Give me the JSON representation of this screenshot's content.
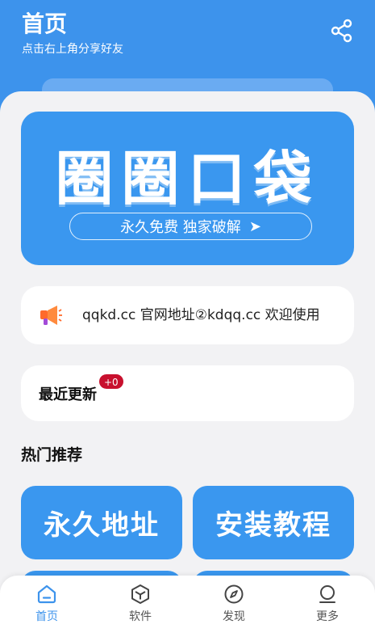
{
  "header": {
    "title": "首页",
    "subtitle": "点击右上角分享好友",
    "share_icon": "share-icon"
  },
  "banner": {
    "title": "圈圈口袋",
    "tagline": "永久免费 独家破解",
    "arrow": "➤"
  },
  "notice": {
    "icon": "megaphone-icon",
    "text": "qqkd.cc 官网地址②kdqq.cc   欢迎使用"
  },
  "recent": {
    "label": "最近更新",
    "badge": "+0"
  },
  "hot": {
    "title": "热门推荐",
    "tiles": [
      {
        "label": "永久地址"
      },
      {
        "label": "安装教程"
      }
    ]
  },
  "tabbar": {
    "items": [
      {
        "label": "首页",
        "icon": "home-icon",
        "active": true
      },
      {
        "label": "软件",
        "icon": "cube-icon",
        "active": false
      },
      {
        "label": "发现",
        "icon": "compass-icon",
        "active": false
      },
      {
        "label": "更多",
        "icon": "user-icon",
        "active": false
      }
    ]
  },
  "colors": {
    "primary": "#3d93ec",
    "badge": "#c8102e"
  }
}
